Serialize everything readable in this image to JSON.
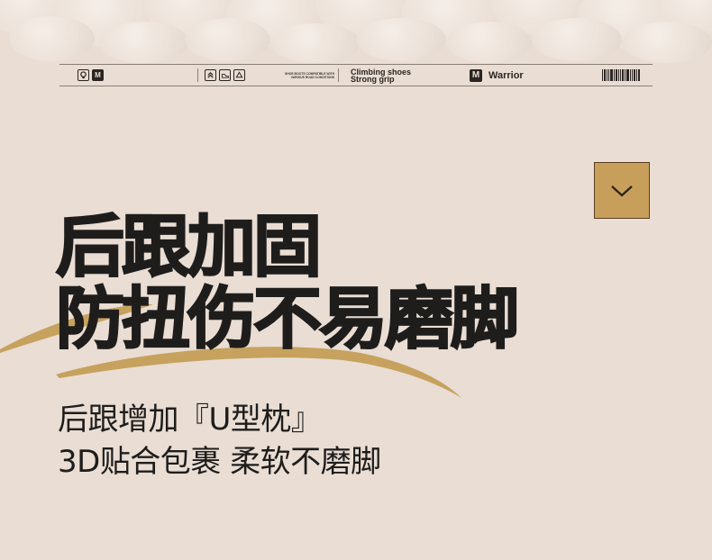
{
  "info_bar": {
    "left_icons": [
      "bulb-icon",
      "brand-m-icon"
    ],
    "mid_icons": [
      "chevrons-up-icon",
      "sneaker-icon",
      "recycle-icon"
    ],
    "small_print": [
      "SHOE BOOTS COMPATIBLE WITH",
      "VARIOUS ROAD CONDITIONS"
    ],
    "slogan_line1": "Climbing shoes",
    "slogan_line2": "Strong grip",
    "brand_mark": "M",
    "brand_name": "Warrior",
    "barcode_icon": "barcode-icon"
  },
  "arrow_button": {
    "icon": "chevron-down-icon",
    "color": "#c79f5b"
  },
  "headline": {
    "line1": "后跟加固",
    "line2": "防扭伤不易磨脚"
  },
  "subtitle": {
    "line1": "后跟增加『U型枕』",
    "line2": "3D贴合包裹 柔软不磨脚"
  },
  "colors": {
    "background": "#e9ddd4",
    "text": "#1e1d1b",
    "accent_gold": "#c79f5b",
    "swoosh": "#c6a25e"
  }
}
